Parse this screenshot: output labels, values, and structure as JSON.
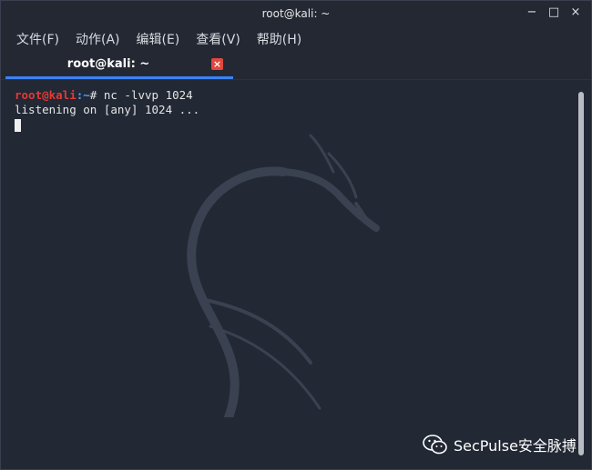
{
  "window": {
    "title": "root@kali: ~",
    "controls": {
      "minimize": "−",
      "maximize": "□",
      "close": "×"
    }
  },
  "menu": [
    "文件(F)",
    "动作(A)",
    "编辑(E)",
    "查看(V)",
    "帮助(H)"
  ],
  "tabs": [
    {
      "label": "root@kali: ~",
      "close": "×",
      "active": true
    }
  ],
  "terminal": {
    "prompt_user": "root@kali",
    "prompt_sep": ":~",
    "prompt_symbol": "# ",
    "command": "nc -lvvp 1024",
    "output_line": "listening on [any] 1024 ..."
  },
  "watermark": {
    "text": "SecPulse安全脉搏",
    "icon": "wechat-icon"
  },
  "colors": {
    "background": "#222834",
    "prompt_user": "#e53935",
    "prompt_path": "#4aa3ff",
    "tab_accent": "#3b82f6",
    "tab_close": "#e0473e"
  }
}
